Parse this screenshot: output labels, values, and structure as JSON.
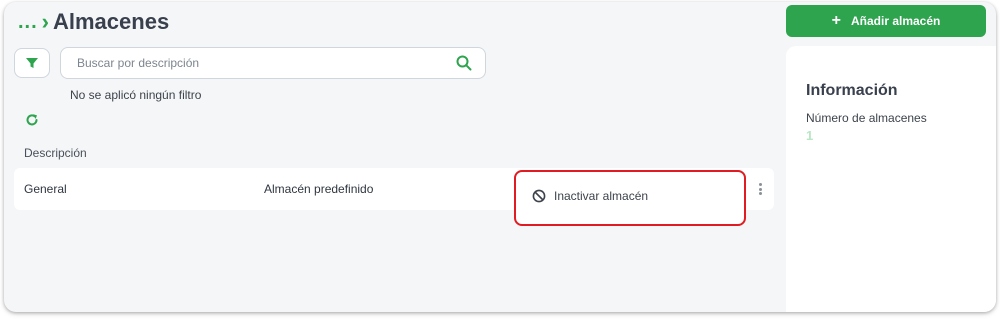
{
  "header": {
    "breadcrumb_ellipsis": "...",
    "breadcrumb_separator": "›",
    "title": "Almacenes"
  },
  "toolbar": {
    "filter_icon": "funnel-icon",
    "search_placeholder": "Buscar por descripción",
    "search_value": "",
    "search_icon": "search-icon",
    "filter_status": "No se aplicó ningún filtro",
    "refresh_icon": "refresh-icon"
  },
  "table": {
    "columns": [
      "Descripción"
    ],
    "rows": [
      {
        "description": "General",
        "type": "Almacén predefinido"
      }
    ]
  },
  "row_menu": {
    "items": [
      {
        "icon": "ban-icon",
        "label": "Inactivar almacén"
      }
    ],
    "highlight_color": "#e01b22"
  },
  "actions": {
    "add_label": "Añadir almacén",
    "add_icon": "plus-icon"
  },
  "info": {
    "title": "Información",
    "count_label": "Número de almacenes",
    "count_value": "1"
  },
  "colors": {
    "accent": "#2ea44f",
    "background": "#f5f6f8",
    "text": "#39404d"
  }
}
